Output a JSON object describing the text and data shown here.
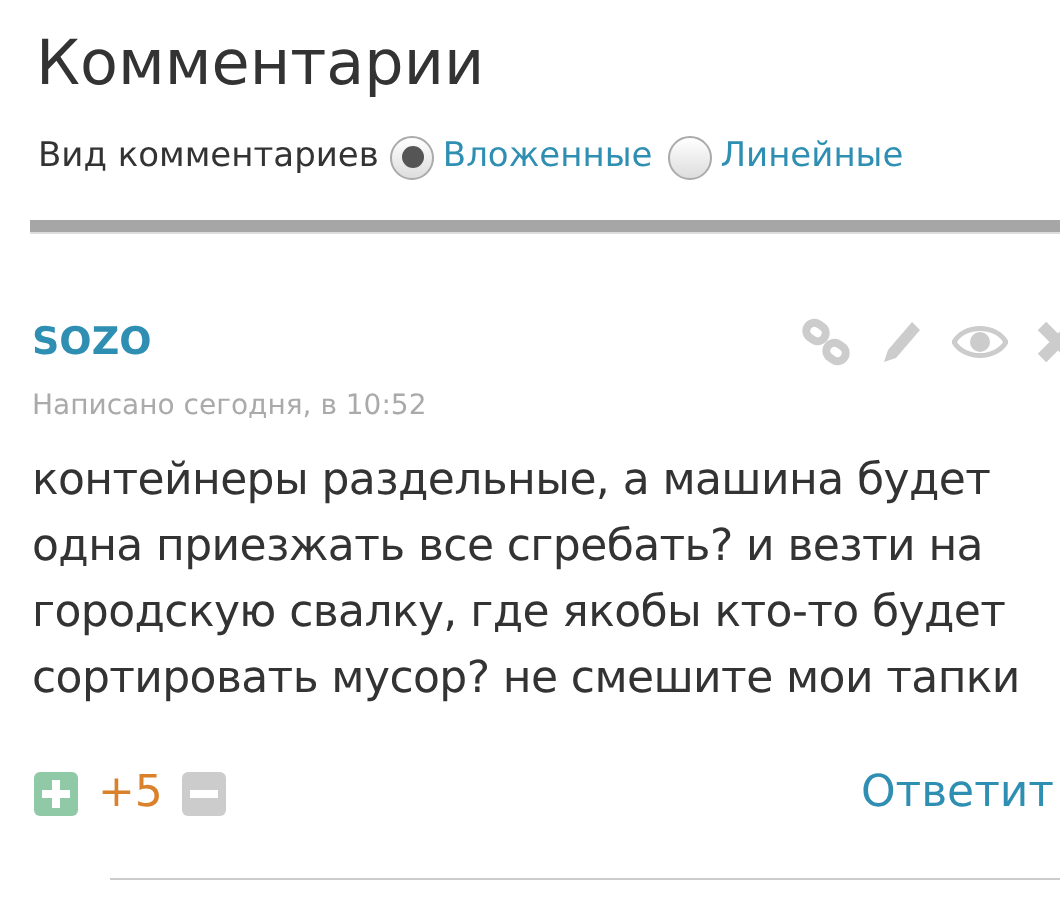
{
  "heading": "Комментарии",
  "view_mode": {
    "label": "Вид комментариев",
    "options": [
      {
        "label": "Вложенные",
        "selected": true
      },
      {
        "label": "Линейные",
        "selected": false
      }
    ]
  },
  "comment": {
    "author": "SOZO",
    "date": "Написано сегодня, в 10:52",
    "text": "контейнеры раздельные, а машина будет одна приезжать все сгребать? и везти на городскую свалку, где якобы кто-то будет сортировать мусор? не смешите мои тапки",
    "rating": "+5",
    "reply": "Ответит"
  }
}
